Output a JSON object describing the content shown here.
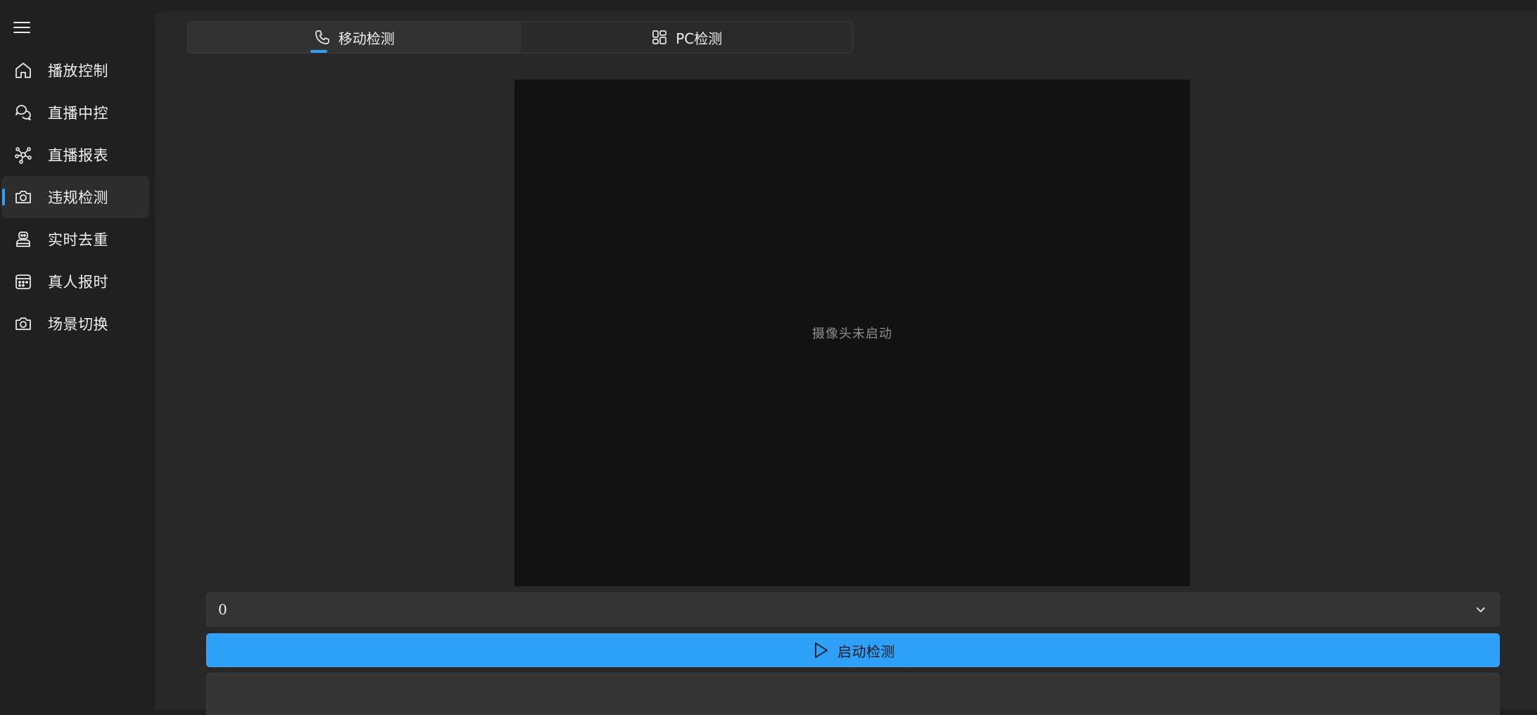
{
  "sidebar": {
    "menu_icon": "hamburger-menu-icon",
    "items": [
      {
        "label": "播放控制",
        "icon": "home-icon",
        "active": false
      },
      {
        "label": "直播中控",
        "icon": "chat-bubbles-icon",
        "active": false
      },
      {
        "label": "直播报表",
        "icon": "network-nodes-icon",
        "active": false
      },
      {
        "label": "违规检测",
        "icon": "camera-icon",
        "active": true
      },
      {
        "label": "实时去重",
        "icon": "robot-icon",
        "active": false
      },
      {
        "label": "真人报时",
        "icon": "calendar-icon",
        "active": false
      },
      {
        "label": "场景切换",
        "icon": "camera-icon",
        "active": false
      }
    ]
  },
  "tabs": [
    {
      "label": "移动检测",
      "icon": "phone-icon",
      "active": true
    },
    {
      "label": "PC检测",
      "icon": "apps-grid-icon",
      "active": false
    }
  ],
  "video": {
    "status_text": "摄像头未启动"
  },
  "camera_select": {
    "value": "0",
    "icon": "chevron-down-icon"
  },
  "start_button": {
    "label": "启动检测",
    "icon": "play-icon"
  },
  "colors": {
    "accent": "#2ea0f8",
    "sidebar_bg": "#202020",
    "main_bg": "#282828",
    "video_bg": "#121212"
  }
}
